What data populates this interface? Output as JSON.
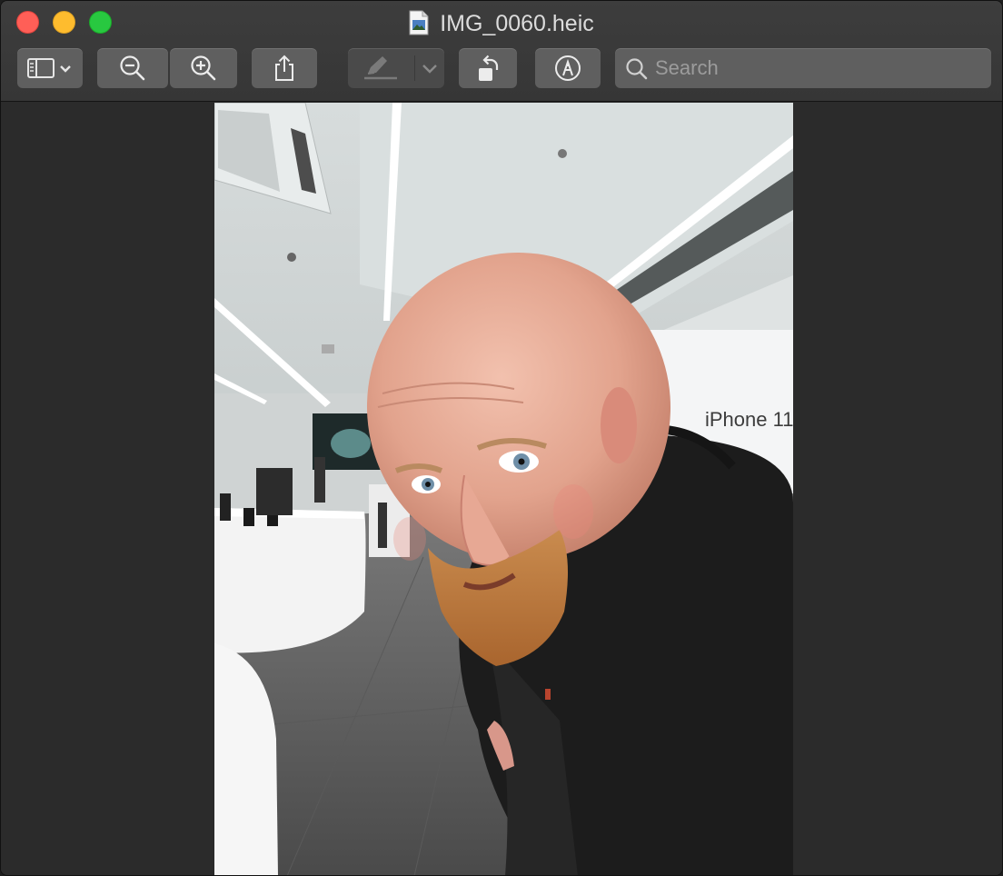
{
  "window": {
    "title": "IMG_0060.heic"
  },
  "toolbar": {
    "sidebar_button": "sidebar-icon",
    "zoom_out": "zoom-out-icon",
    "zoom_in": "zoom-in-icon",
    "share": "share-icon",
    "highlight": "highlighter-icon",
    "rotate": "rotate-left-icon",
    "markup": "markup-icon"
  },
  "search": {
    "placeholder": "Search",
    "value": ""
  },
  "photo": {
    "sign_text": "iPhone 11"
  },
  "colors": {
    "close": "#ff5f57",
    "minimize": "#febc2e",
    "zoom": "#28c840",
    "toolbar_button": "#5f5f5f"
  }
}
